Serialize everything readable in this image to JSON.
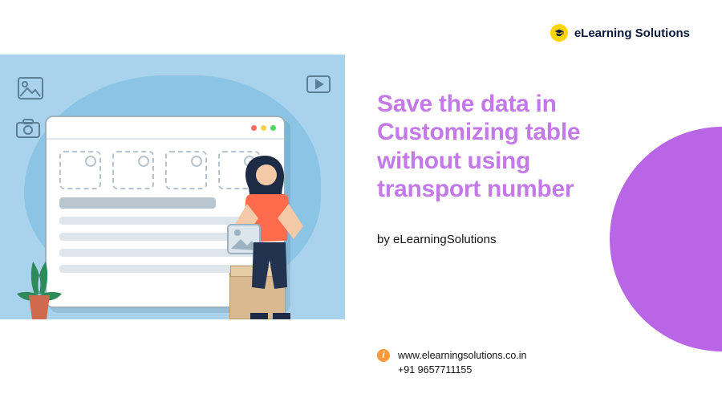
{
  "brand": {
    "name": "eLearning Solutions"
  },
  "title": "Save the data in Customizing table without using transport number",
  "byline": "by eLearningSolutions",
  "contact": {
    "website": "www.elearningsolutions.co.in",
    "phone": "+91 9657711155"
  },
  "colors": {
    "accent_purple": "#b966e6",
    "title_purple": "#c37ae8",
    "illus_bg": "#a9d3ec",
    "logo_yellow": "#ffd400"
  }
}
